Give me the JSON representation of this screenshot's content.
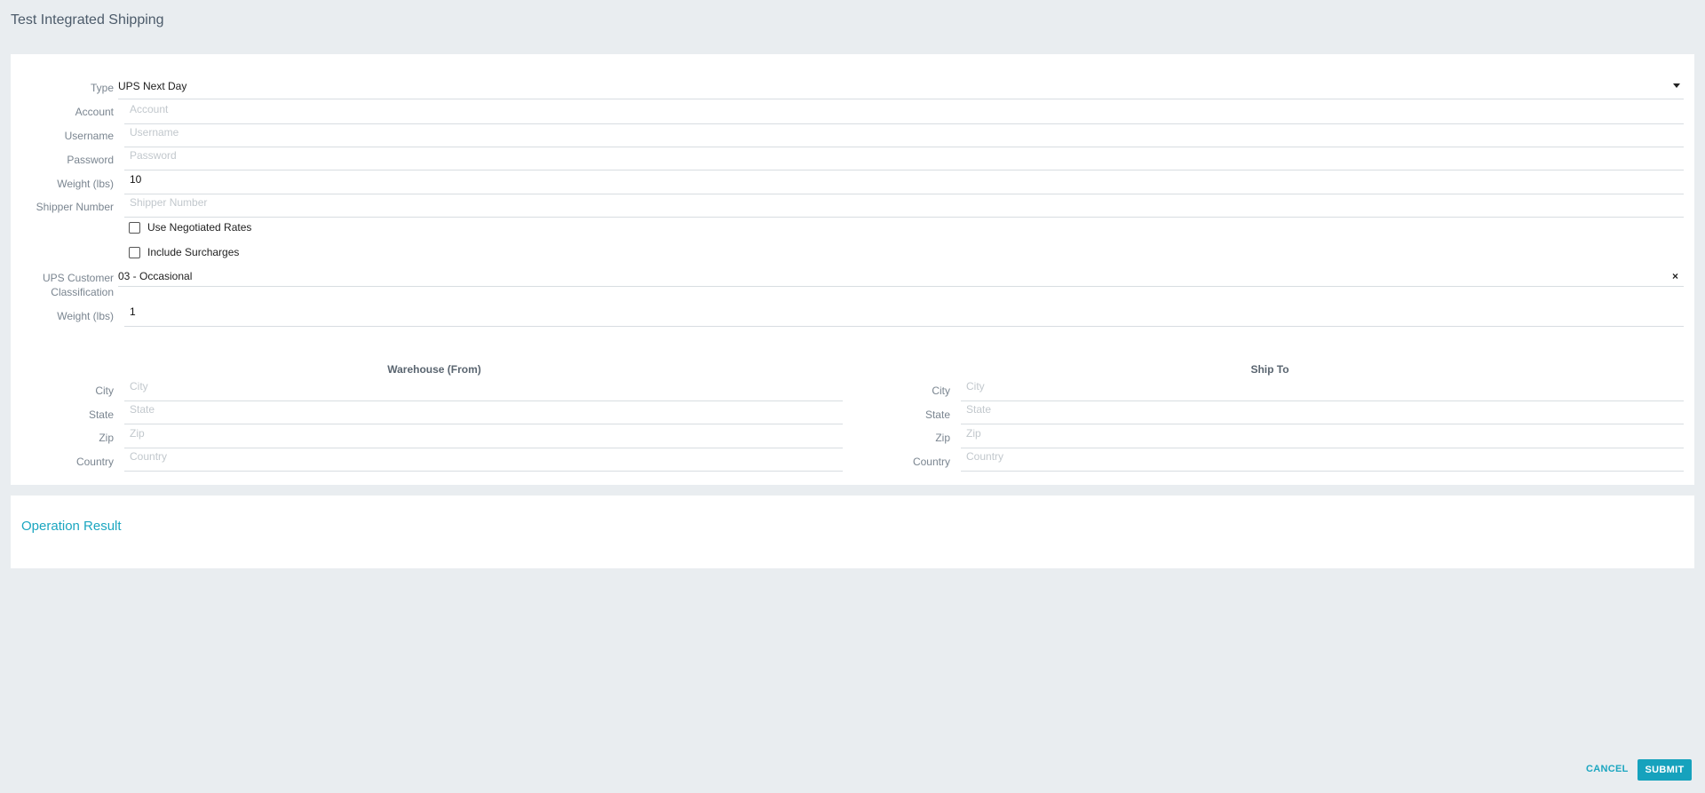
{
  "page": {
    "title": "Test Integrated Shipping"
  },
  "form": {
    "type": {
      "label": "Type",
      "value": "UPS Next Day"
    },
    "account": {
      "label": "Account",
      "placeholder": "Account",
      "value": ""
    },
    "username": {
      "label": "Username",
      "placeholder": "Username",
      "value": ""
    },
    "password": {
      "label": "Password",
      "placeholder": "Password",
      "value": ""
    },
    "weight1": {
      "label": "Weight (lbs)",
      "value": "10"
    },
    "shipper_number": {
      "label": "Shipper Number",
      "placeholder": "Shipper Number",
      "value": ""
    },
    "negotiated": {
      "label": "Use Negotiated Rates",
      "checked": false
    },
    "surcharges": {
      "label": "Include Surcharges",
      "checked": false
    },
    "classification": {
      "label_line1": "UPS Customer",
      "label_line2": "Classification",
      "value": "03 - Occasional",
      "clear": "×"
    },
    "weight2": {
      "label": "Weight (lbs)",
      "value": "1"
    }
  },
  "warehouse": {
    "heading": "Warehouse (From)",
    "city": {
      "label": "City",
      "placeholder": "City"
    },
    "state": {
      "label": "State",
      "placeholder": "State"
    },
    "zip": {
      "label": "Zip",
      "placeholder": "Zip"
    },
    "country": {
      "label": "Country",
      "placeholder": "Country"
    }
  },
  "shipto": {
    "heading": "Ship To",
    "city": {
      "label": "City",
      "placeholder": "City"
    },
    "state": {
      "label": "State",
      "placeholder": "State"
    },
    "zip": {
      "label": "Zip",
      "placeholder": "Zip"
    },
    "country": {
      "label": "Country",
      "placeholder": "Country"
    }
  },
  "result": {
    "title": "Operation Result"
  },
  "actions": {
    "cancel": "CANCEL",
    "submit": "SUBMIT"
  },
  "colors": {
    "accent": "#16a2bd",
    "background": "#e9edf0",
    "card": "#ffffff"
  }
}
